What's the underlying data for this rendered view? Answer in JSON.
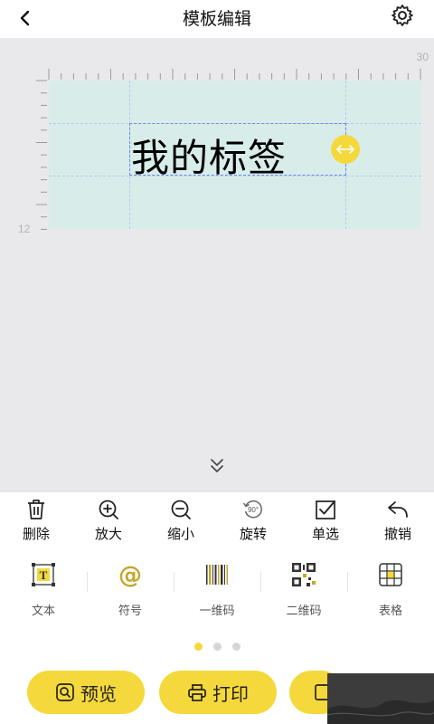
{
  "header": {
    "title": "模板编辑",
    "back_icon": "chevron-left-icon",
    "settings_icon": "gear-icon"
  },
  "canvas": {
    "ruler_top_max": "30",
    "ruler_left_max": "12",
    "label_text": "我的标签",
    "label_color": "#d8edea"
  },
  "toolbar": {
    "items": [
      {
        "label": "删除",
        "icon": "trash-icon"
      },
      {
        "label": "放大",
        "icon": "zoom-in-icon"
      },
      {
        "label": "缩小",
        "icon": "zoom-out-icon"
      },
      {
        "label": "旋转",
        "icon": "rotate-90-icon"
      },
      {
        "label": "单选",
        "icon": "checkbox-icon"
      },
      {
        "label": "撤销",
        "icon": "undo-icon"
      }
    ]
  },
  "inserts": {
    "items": [
      {
        "label": "文本",
        "icon": "text-icon"
      },
      {
        "label": "符号",
        "icon": "at-symbol-icon"
      },
      {
        "label": "一维码",
        "icon": "barcode-icon"
      },
      {
        "label": "二维码",
        "icon": "qr-code-icon"
      },
      {
        "label": "表格",
        "icon": "table-icon"
      }
    ]
  },
  "pager": {
    "pages": 3,
    "current": 1
  },
  "actions": {
    "preview_label": "预览",
    "print_label": "打印"
  },
  "colors": {
    "accent": "#f5d93c",
    "canvas_bg": "#e9e9eb"
  }
}
